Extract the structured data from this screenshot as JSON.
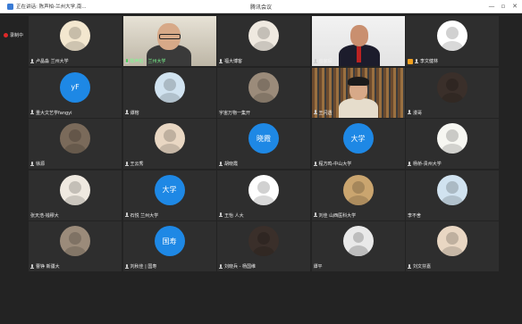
{
  "titlebar": {
    "tab_label": "正在讲话: 陈声柏-兰州大学,南...",
    "title": "腾讯会议",
    "minimize_glyph": "—",
    "maximize_glyph": "▫",
    "close_glyph": "✕"
  },
  "recording": {
    "label": "录制中",
    "color": "#e02828"
  },
  "colors": {
    "accent_text_avatar": "#1e88e5",
    "speaking": "#4ccf5d",
    "background": "#232323"
  },
  "tiles": [
    {
      "name": "卢晶淼 兰州大学",
      "avatar": "image",
      "mic": "on"
    },
    {
      "name": "陈声柏 - 兰州大学",
      "avatar": "video",
      "mic": "talk",
      "active": true
    },
    {
      "name": "福大博客",
      "avatar": "image",
      "mic": "on"
    },
    {
      "name": "曾家琛",
      "avatar": "video",
      "mic": "on"
    },
    {
      "name": "李文健林",
      "avatar": "image",
      "mic": "on",
      "host_badge": true
    },
    {
      "name": "重大文艺学fangyi",
      "avatar": "text",
      "avatar_text": "yF",
      "mic": "on"
    },
    {
      "name": "谭榕",
      "avatar": "image",
      "mic": "on"
    },
    {
      "name": "宇宙万物一集开",
      "avatar": "image",
      "mic": "none"
    },
    {
      "name": "王闪透",
      "avatar": "video",
      "mic": "on"
    },
    {
      "name": "漫哥",
      "avatar": "image",
      "mic": "on"
    },
    {
      "name": "徐源",
      "avatar": "image",
      "mic": "on"
    },
    {
      "name": "王云秀",
      "avatar": "image",
      "mic": "on"
    },
    {
      "name": "胡晓霞",
      "avatar": "text",
      "avatar_text": "晓霞",
      "mic": "on"
    },
    {
      "name": "程方鸣-中山大学",
      "avatar": "text",
      "avatar_text": "大学",
      "mic": "on"
    },
    {
      "name": "杨桥-贵州大学",
      "avatar": "image",
      "mic": "on"
    },
    {
      "name": "张天浩-钱穆大",
      "avatar": "image",
      "mic": "none"
    },
    {
      "name": "石悦 兰州大学",
      "avatar": "text",
      "avatar_text": "大学",
      "mic": "on"
    },
    {
      "name": "王怡 人大",
      "avatar": "image",
      "mic": "on"
    },
    {
      "name": "刘佳 山西医科大学",
      "avatar": "image",
      "mic": "on"
    },
    {
      "name": "李不舍",
      "avatar": "image",
      "mic": "none"
    },
    {
      "name": "曹铮 新疆大",
      "avatar": "image",
      "mic": "on"
    },
    {
      "name": "刘秋佳 | 国寿",
      "avatar": "text",
      "avatar_text": "国寿",
      "mic": "on"
    },
    {
      "name": "刘晓兵 - 杨国维",
      "avatar": "image",
      "mic": "on"
    },
    {
      "name": "谭平",
      "avatar": "placeholder",
      "mic": "none"
    },
    {
      "name": "刘文芬嘉",
      "avatar": "image",
      "mic": "on"
    }
  ]
}
